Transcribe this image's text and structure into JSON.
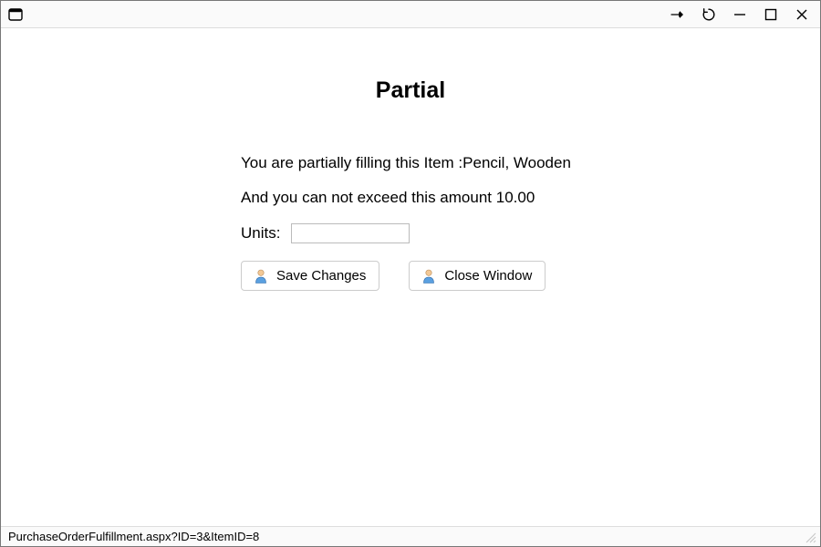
{
  "heading": "Partial",
  "line1_prefix": "You are partially filling this Item :",
  "item_name": "Pencil, Wooden",
  "line2_prefix": "And you can not exceed this amount ",
  "max_amount": "10.00",
  "units_label": "Units:",
  "units_value": "",
  "buttons": {
    "save_label": "Save Changes",
    "close_label": "Close Window"
  },
  "status_text": "PurchaseOrderFulfillment.aspx?ID=3&ItemID=8"
}
